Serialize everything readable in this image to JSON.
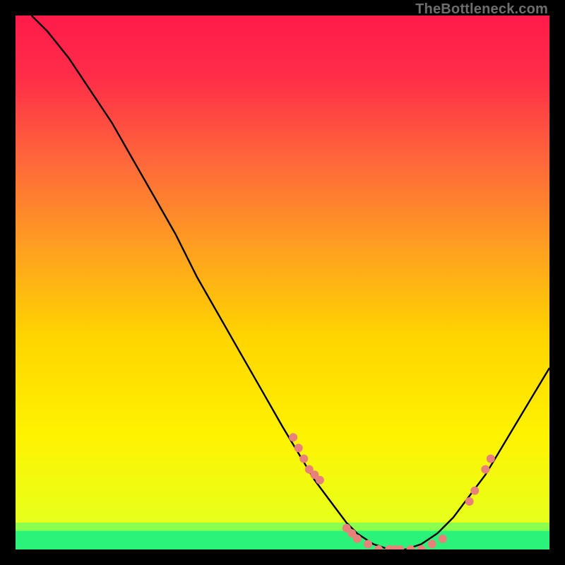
{
  "watermark": "TheBottleneck.com",
  "chart_data": {
    "type": "line",
    "title": "",
    "xlabel": "",
    "ylabel": "",
    "xlim": [
      0,
      100
    ],
    "ylim": [
      0,
      100
    ],
    "grid": false,
    "legend": false,
    "background_gradient": {
      "top": "#ff1a4b",
      "mid": "#ffe500",
      "bottom_band": "#2bf37a"
    },
    "series": [
      {
        "name": "curve",
        "type": "line",
        "color": "#000000",
        "x": [
          3,
          6,
          10,
          14,
          18,
          22,
          26,
          30,
          34,
          38,
          42,
          46,
          50,
          53,
          56,
          59,
          62,
          64,
          67,
          70,
          73,
          76,
          79,
          82,
          85,
          88,
          91,
          94,
          97,
          100
        ],
        "y": [
          100,
          97,
          92,
          86,
          80,
          73,
          66,
          59,
          51,
          44,
          37,
          30,
          23,
          18,
          13,
          9,
          5,
          3,
          1,
          0,
          0,
          1,
          3,
          6,
          10,
          14,
          19,
          24,
          29,
          34
        ]
      },
      {
        "name": "markers",
        "type": "scatter",
        "color": "#e8817a",
        "x": [
          52,
          53,
          54,
          55,
          56,
          57,
          62,
          63,
          64,
          66,
          68,
          70,
          71,
          72,
          74,
          76,
          78,
          80,
          85,
          86,
          88,
          89
        ],
        "y": [
          21,
          19,
          17,
          15,
          14,
          13,
          4,
          3,
          2,
          1,
          0,
          0,
          0,
          0,
          0,
          0,
          1,
          2,
          9,
          11,
          15,
          17
        ]
      }
    ]
  }
}
